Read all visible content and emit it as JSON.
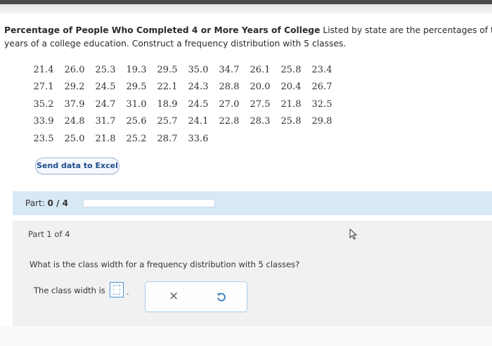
{
  "question": {
    "title_bold": "Percentage of People Who Completed 4 or More Years of College",
    "line1_rest": " Listed by state are the percentages of the pe",
    "line2": "years of a college education. Construct a frequency distribution with 5 classes."
  },
  "data_rows": [
    [
      "21.4",
      "26.0",
      "25.3",
      "19.3",
      "29.5",
      "35.0",
      "34.7",
      "26.1",
      "25.8",
      "23.4"
    ],
    [
      "27.1",
      "29.2",
      "24.5",
      "29.5",
      "22.1",
      "24.3",
      "28.8",
      "20.0",
      "20.4",
      "26.7"
    ],
    [
      "35.2",
      "37.9",
      "24.7",
      "31.0",
      "18.9",
      "24.5",
      "27.0",
      "27.5",
      "21.8",
      "32.5"
    ],
    [
      "33.9",
      "24.8",
      "31.7",
      "25.6",
      "25.7",
      "24.1",
      "22.8",
      "28.3",
      "25.8",
      "29.8"
    ],
    [
      "23.5",
      "25.0",
      "21.8",
      "25.2",
      "28.7",
      "33.6"
    ]
  ],
  "excel_button": "Send data to Excel",
  "part": {
    "label_prefix": "Part: ",
    "label_value": "0 / 4",
    "progress_fraction": 0.0
  },
  "part_panel": {
    "part_of": "Part 1 of 4",
    "prompt": "What is the class width for a frequency distribution with 5 classes?",
    "answer_label": "The class width is",
    "answer_value": "",
    "period": "."
  },
  "actions": {
    "clear_symbol": "×",
    "undo_icon": "undo-icon"
  },
  "colors": {
    "part_bar": "#d8e9f6",
    "input_border": "#4f93cf",
    "button_text": "#1e4d8b"
  }
}
